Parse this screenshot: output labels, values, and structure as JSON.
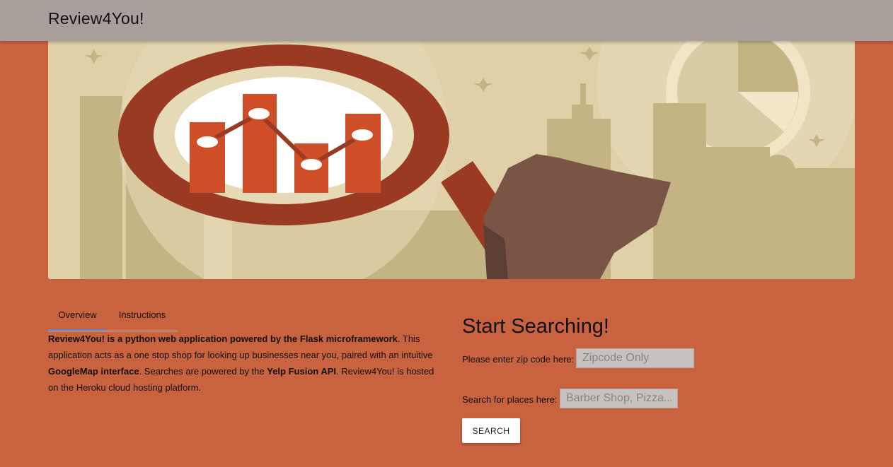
{
  "navbar": {
    "brand": "Review4You!"
  },
  "hero": {
    "alt": "Magnifying glass over a bar chart with city skyline"
  },
  "tabs": [
    {
      "label": "Overview",
      "active": true
    },
    {
      "label": "Instructions",
      "active": false
    }
  ],
  "overview": {
    "p1_bold": "Review4You! is a python web application powered by the Flask microframework",
    "p2": ". This application acts as a one stop shop for looking up businesses near you, paired with an intuitive ",
    "p3_bold": "GoogleMap interface",
    "p4": ". Searches are powered by the ",
    "p5_bold": "Yelp Fusion API",
    "p6": ". Review4You! is hosted on the Heroku cloud hosting platform."
  },
  "search": {
    "title": "Start Searching!",
    "zip_label": "Please enter zip code here:",
    "zip_placeholder": "Zipcode Only",
    "place_label": "Search for places here:",
    "place_placeholder": "Barber Shop, Pizza...",
    "button_label": "SEARCH"
  },
  "colors": {
    "background": "#c9623f",
    "navbar": "#a89f9a",
    "tab_indicator": "#4a7bd0"
  }
}
